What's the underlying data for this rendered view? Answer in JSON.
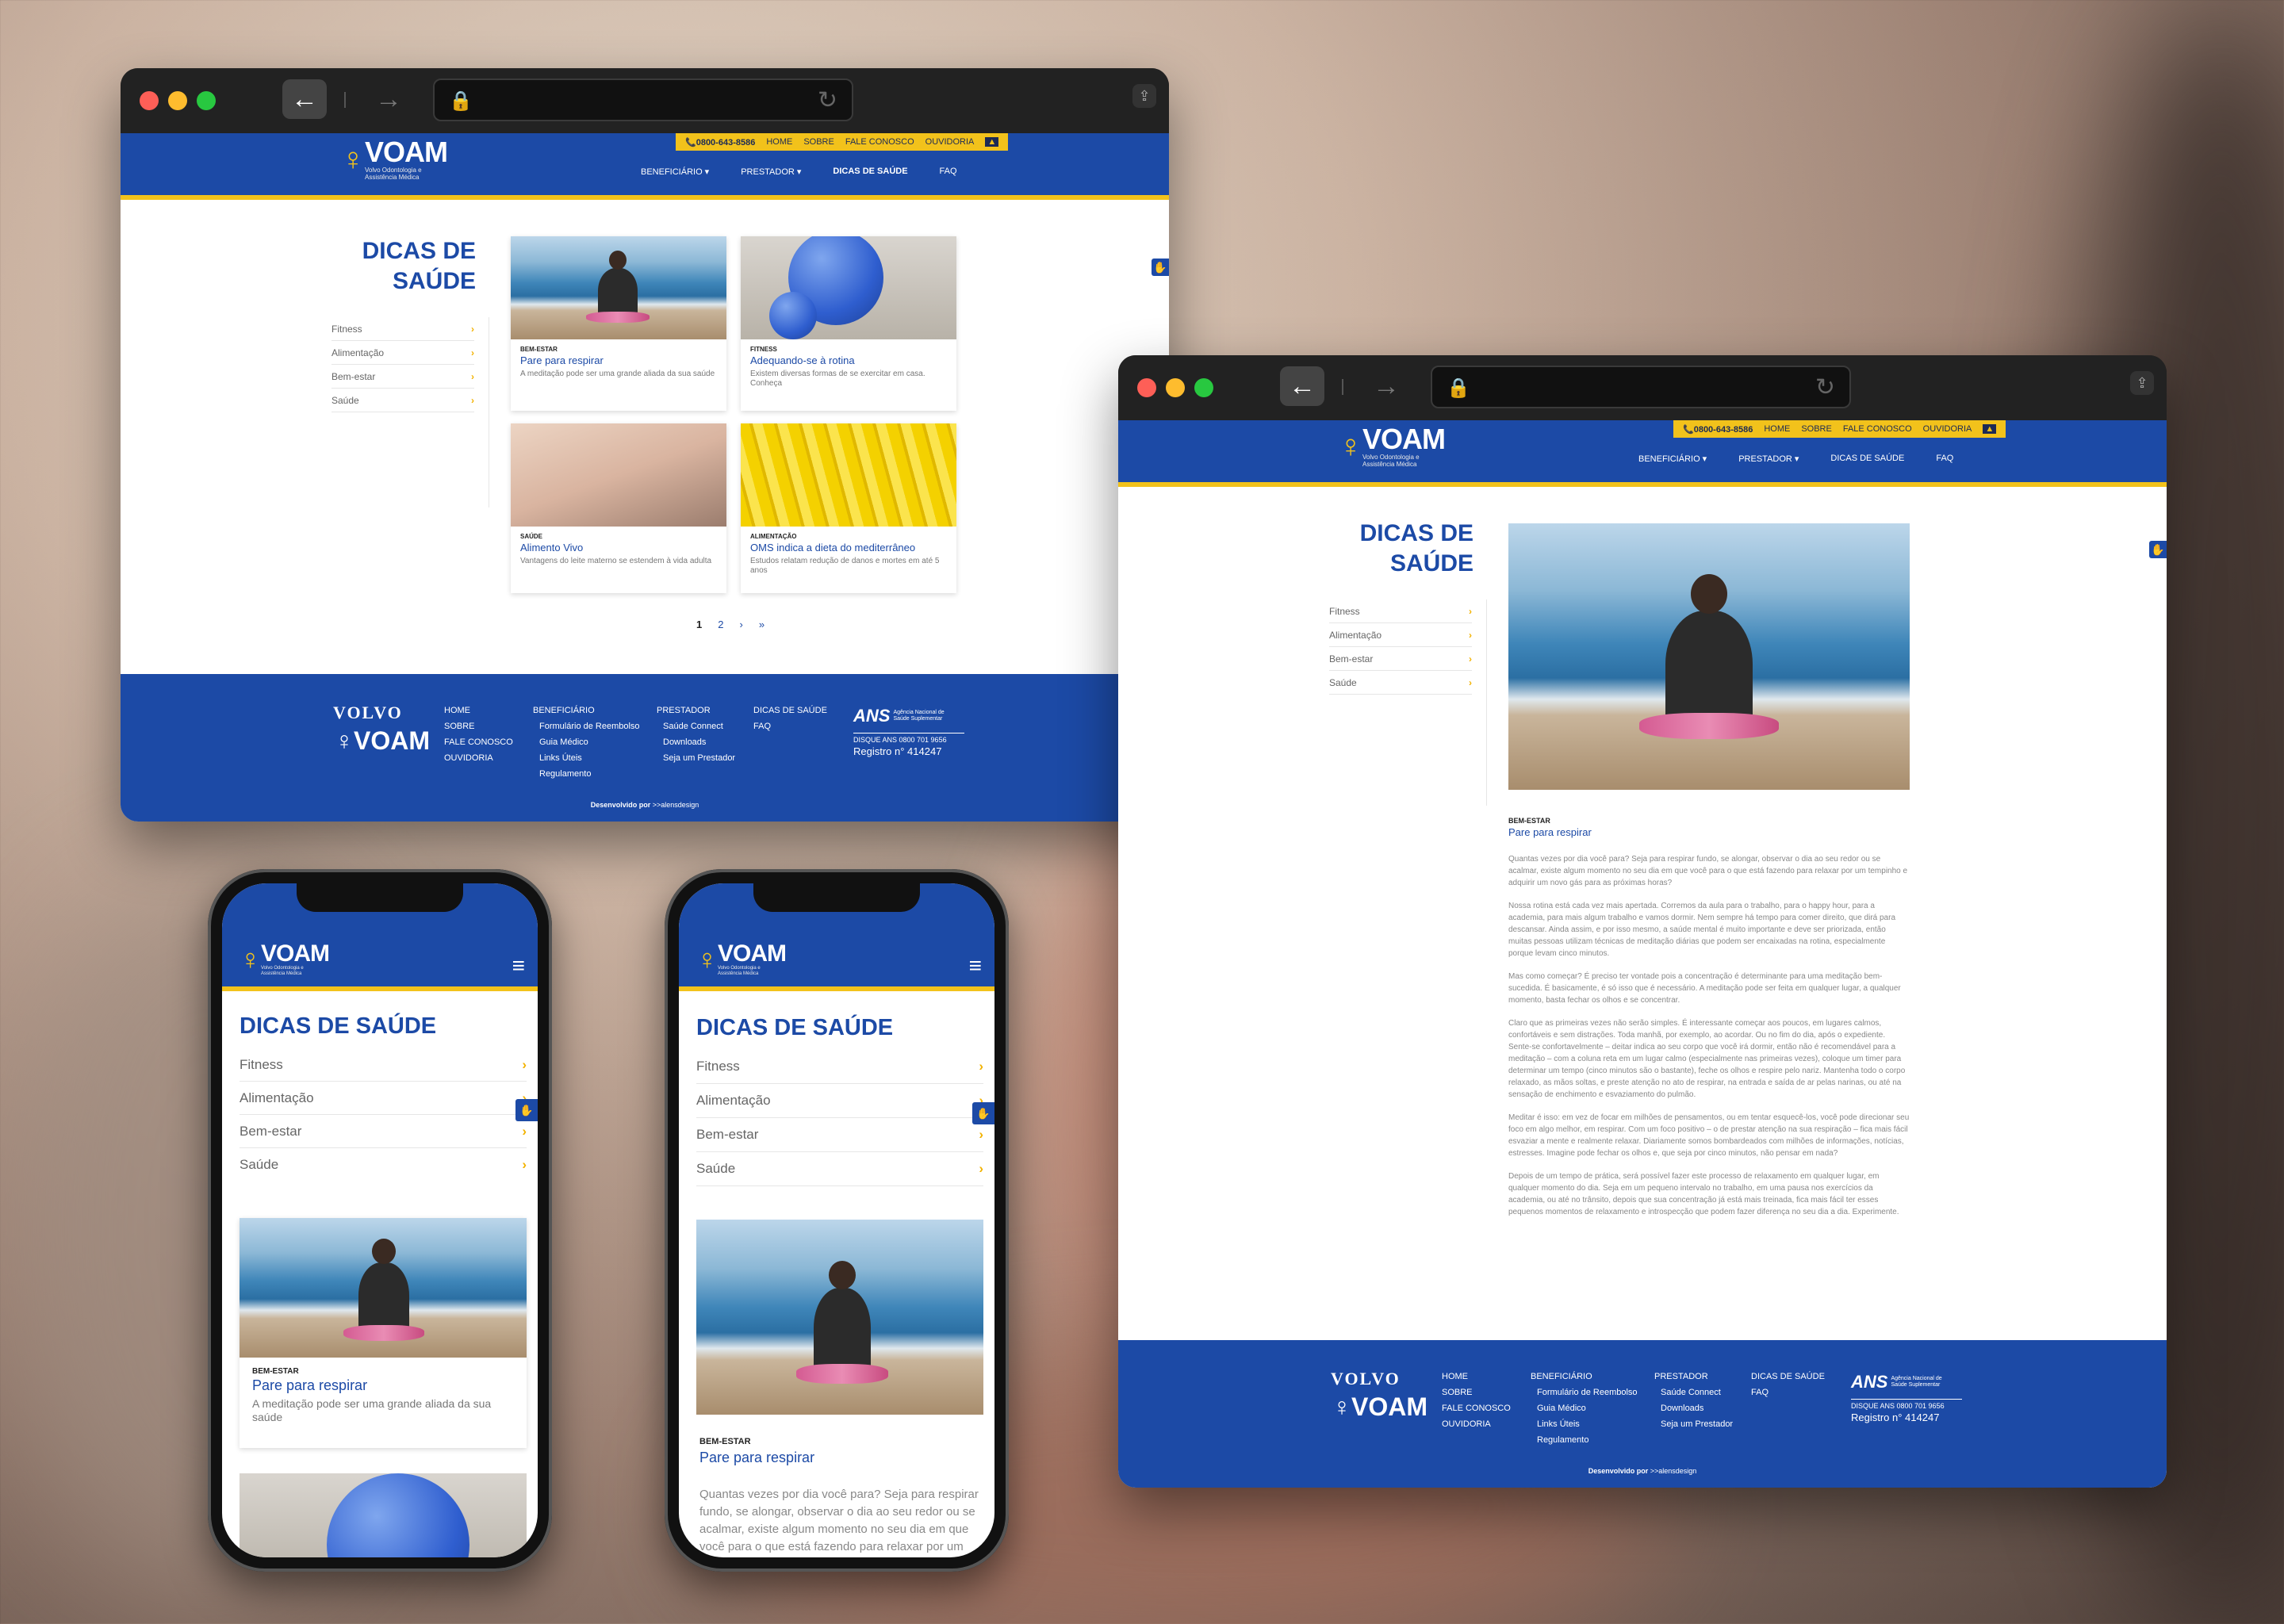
{
  "site": {
    "brand": "VOAM",
    "brand_sub": "Volvo Odontologia e Assistência Médica",
    "phone": "0800-643-8586",
    "top_links": [
      "HOME",
      "SOBRE",
      "FALE CONOSCO",
      "OUVIDORIA"
    ],
    "nav": [
      {
        "label": "BENEFICIÁRIO",
        "has_menu": true
      },
      {
        "label": "PRESTADOR",
        "has_menu": true
      },
      {
        "label": "DICAS DE SAÚDE",
        "has_menu": false
      },
      {
        "label": "FAQ",
        "has_menu": false
      }
    ],
    "page_title": "DICAS DE SAÚDE",
    "page_title_l1": "DICAS DE",
    "page_title_l2": "SAÚDE",
    "categories": [
      "Fitness",
      "Alimentação",
      "Bem-estar",
      "Saúde"
    ]
  },
  "cards": [
    {
      "tag": "BEM-ESTAR",
      "title": "Pare para respirar",
      "desc": "A meditação pode ser uma grande aliada da sua saúde",
      "image": "woman-meditating-beach"
    },
    {
      "tag": "FITNESS",
      "title": "Adequando-se à rotina",
      "desc": "Existem diversas formas de se exercitar em casa. Conheça",
      "image": "blue-exercise-balls"
    },
    {
      "tag": "SAÚDE",
      "title": "Alimento Vivo",
      "desc": "Vantagens do leite materno se estendem à vida adulta",
      "image": "baby"
    },
    {
      "tag": "ALIMENTAÇÃO",
      "title": "OMS indica a dieta do mediterrâneo",
      "desc": "Estudos relatam redução de danos e mortes em até 5 anos",
      "image": "bananas"
    }
  ],
  "pagination": [
    "1",
    "2",
    "›",
    "»"
  ],
  "footer": {
    "volvo": "VOLVO",
    "col1": [
      "HOME",
      "SOBRE",
      "FALE CONOSCO",
      "OUVIDORIA"
    ],
    "col2_title": "BENEFICIÁRIO",
    "col2": [
      "Formulário de Reembolso",
      "Guia Médico",
      "Links Úteis",
      "Regulamento"
    ],
    "col3_title": "PRESTADOR",
    "col3": [
      "Saúde Connect",
      "Downloads",
      "Seja um Prestador"
    ],
    "col4": [
      "DICAS DE SAÚDE",
      "FAQ"
    ],
    "ans_label": "ANS",
    "ans_sub": "Agência Nacional de Saúde Suplementar",
    "ans_phone": "DISQUE ANS 0800 701 9656",
    "ans_reg": "Registro n° 414247",
    "credit_prefix": "Desenvolvido por",
    "credit_name": ">>alensdesign"
  },
  "article": {
    "tag": "BEM-ESTAR",
    "title": "Pare para respirar",
    "paragraphs": [
      "Quantas vezes por dia você para? Seja para respirar fundo, se alongar, observar o dia ao seu redor ou se acalmar, existe algum momento no seu dia em que você para o que está fazendo para relaxar por um tempinho e adquirir um novo gás para as próximas horas?",
      "Nossa rotina está cada vez mais apertada. Corremos da aula para o trabalho, para o happy hour, para a academia, para mais algum trabalho e vamos dormir. Nem sempre há tempo para comer direito, que dirá para descansar. Ainda assim, e por isso mesmo, a saúde mental é muito importante e deve ser priorizada, então muitas pessoas utilizam técnicas de meditação diárias que podem ser encaixadas na rotina, especialmente porque levam cinco minutos.",
      "Mas como começar? É preciso ter vontade pois a concentração é determinante para uma meditação bem-sucedida. É basicamente, é só isso que é necessário. A meditação pode ser feita em qualquer lugar, a qualquer momento, basta fechar os olhos e se concentrar.",
      "Claro que as primeiras vezes não serão simples. É interessante começar aos poucos, em lugares calmos, confortáveis e sem distrações. Toda manhã, por exemplo, ao acordar. Ou no fim do dia, após o expediente. Sente-se confortavelmente – deitar indica ao seu corpo que você irá dormir, então não é recomendável para a meditação – com a coluna reta em um lugar calmo (especialmente nas primeiras vezes), coloque um timer para determinar um tempo (cinco minutos são o bastante), feche os olhos e respire pelo nariz. Mantenha todo o corpo relaxado, as mãos soltas, e preste atenção no ato de respirar, na entrada e saída de ar pelas narinas, ou até na sensação de enchimento e esvaziamento do pulmão.",
      "Meditar é isso: em vez de focar em milhões de pensamentos, ou em tentar esquecê-los, você pode direcionar seu foco em algo melhor, em respirar. Com um foco positivo – o de prestar atenção na sua respiração – fica mais fácil esvaziar a mente e realmente relaxar. Diariamente somos bombardeados com milhões de informações, notícias, estresses. Imagine pode fechar os olhos e, que seja por cinco minutos, não pensar em nada?",
      "Depois de um tempo de prática, será possível fazer este processo de relaxamento em qualquer lugar, em qualquer momento do dia. Seja em um pequeno intervalo no trabalho, em uma pausa nos exercícios da academia, ou até no trânsito, depois que sua concentração já está mais treinada, fica mais fácil ter esses pequenos momentos de relaxamento e introspecção que podem fazer diferença no seu dia a dia. Experimente."
    ],
    "mobile_excerpt": "Quantas vezes por dia você para? Seja para respirar fundo, se alongar, observar o dia ao seu redor ou se acalmar, existe algum momento no seu dia em que você para o que está fazendo para relaxar por um tempinho e adquirir um novo gás para as próximas"
  },
  "colors": {
    "brand_blue": "#1c4aa6",
    "accent_yellow": "#f2c21b"
  },
  "icons": {
    "back": "arrow-left-icon",
    "forward": "arrow-right-icon",
    "lock": "lock-icon",
    "reload": "reload-icon",
    "share": "share-icon",
    "menu": "hamburger-icon",
    "accessibility": "accessibility-hand-icon"
  }
}
